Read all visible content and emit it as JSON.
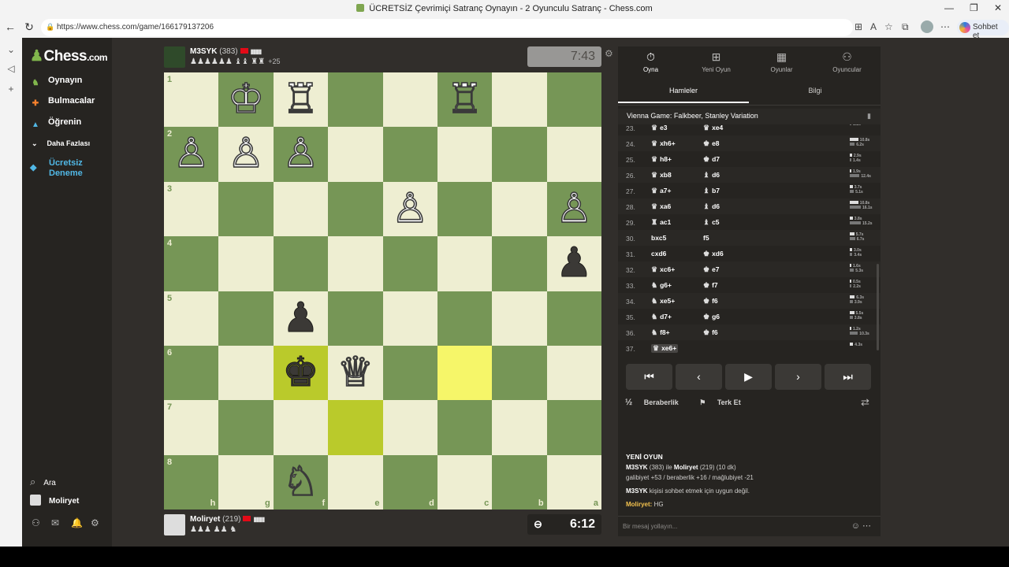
{
  "window": {
    "title": "ÜCRETSİZ Çevrimiçi Satranç Oynayın - 2 Oyunculu Satranç - Chess.com"
  },
  "browser": {
    "url": "https://www.chess.com/game/166179137206",
    "copilot_label": "Sohbet et"
  },
  "leftnav": {
    "logo": "Chess",
    "logo_suffix": ".com",
    "items": [
      {
        "label": "Oynayın",
        "icon": "play-icon",
        "color": "#81b64c"
      },
      {
        "label": "Bulmacalar",
        "icon": "puzzle-icon",
        "color": "#f7812d"
      },
      {
        "label": "Öğrenin",
        "icon": "learn-icon",
        "color": "#51b8e6"
      }
    ],
    "more_label": "Daha Fazlası",
    "trial_line1": "Ücretsiz",
    "trial_line2": "Deneme",
    "search_label": "Ara",
    "user_label": "Moliryet"
  },
  "top_player": {
    "name": "M3SYK",
    "rating": "(383)",
    "captured": "♟♟♟♟♟♟ ♝♝ ♜♜",
    "advantage": "+25",
    "clock": "7:43"
  },
  "bottom_player": {
    "name": "Moliryet",
    "rating": "(219)",
    "captured": "♟♟♟ ♟♟ ♞",
    "clock": "6:12"
  },
  "board": {
    "ranks": [
      "1",
      "2",
      "3",
      "4",
      "5",
      "6",
      "7",
      "8"
    ],
    "files": [
      "h",
      "g",
      "f",
      "e",
      "d",
      "c",
      "b",
      "a"
    ],
    "highlights": [
      "5-2",
      "5-5",
      "6-3"
    ],
    "pieces": [
      {
        "sq": "0-1",
        "p": "♔",
        "c": "w"
      },
      {
        "sq": "0-2",
        "p": "♖",
        "c": "w"
      },
      {
        "sq": "0-5",
        "p": "♖",
        "c": "w"
      },
      {
        "sq": "1-0",
        "p": "♙",
        "c": "w"
      },
      {
        "sq": "1-1",
        "p": "♙",
        "c": "w"
      },
      {
        "sq": "1-2",
        "p": "♙",
        "c": "w"
      },
      {
        "sq": "2-4",
        "p": "♙",
        "c": "w"
      },
      {
        "sq": "2-7",
        "p": "♙",
        "c": "w"
      },
      {
        "sq": "3-7",
        "p": "♟",
        "c": "b"
      },
      {
        "sq": "4-2",
        "p": "♟",
        "c": "b"
      },
      {
        "sq": "5-2",
        "p": "♚",
        "c": "b"
      },
      {
        "sq": "5-3",
        "p": "♕",
        "c": "w"
      },
      {
        "sq": "7-2",
        "p": "♘",
        "c": "w"
      }
    ]
  },
  "panel": {
    "tabs": [
      {
        "label": "Oyna",
        "icon": "clock-icon"
      },
      {
        "label": "Yeni Oyun",
        "icon": "plus-icon"
      },
      {
        "label": "Oyunlar",
        "icon": "board-icon"
      },
      {
        "label": "Oyuncular",
        "icon": "players-icon"
      }
    ],
    "subtabs": [
      "Hamleler",
      "Bilgi"
    ],
    "opening": "Vienna Game: Falkbeer, Stanley Variation",
    "moves": [
      {
        "n": "23.",
        "w": "e3",
        "wp": "♛",
        "b": "xe4",
        "bp": "♛",
        "tw": "",
        "tb": "2.2s"
      },
      {
        "n": "24.",
        "w": "xh6+",
        "wp": "♛",
        "b": "e8",
        "bp": "♚",
        "tw": "10.8s",
        "tb": "6.2s"
      },
      {
        "n": "25.",
        "w": "h8+",
        "wp": "♛",
        "b": "d7",
        "bp": "♚",
        "tw": "2.9s",
        "tb": "1.4s"
      },
      {
        "n": "26.",
        "w": "xb8",
        "wp": "♛",
        "b": "d6",
        "bp": "♝",
        "tw": "1.9s",
        "tb": "12.4s"
      },
      {
        "n": "27.",
        "w": "a7+",
        "wp": "♛",
        "b": "b7",
        "bp": "♝",
        "tw": "3.7s",
        "tb": "5.1s"
      },
      {
        "n": "28.",
        "w": "xa6",
        "wp": "♛",
        "b": "d6",
        "bp": "♝",
        "tw": "10.8s",
        "tb": "16.1s"
      },
      {
        "n": "29.",
        "w": "ac1",
        "wp": "♜",
        "b": "c5",
        "bp": "♝",
        "tw": "3.8s",
        "tb": "15.2s"
      },
      {
        "n": "30.",
        "w": "bxc5",
        "wp": "",
        "b": "f5",
        "bp": "",
        "tw": "5.7s",
        "tb": "6.7s"
      },
      {
        "n": "31.",
        "w": "cxd6",
        "wp": "",
        "b": "xd6",
        "bp": "♚",
        "tw": "3.0s",
        "tb": "3.4s"
      },
      {
        "n": "32.",
        "w": "xc6+",
        "wp": "♛",
        "b": "e7",
        "bp": "♚",
        "tw": "1.6s",
        "tb": "5.3s"
      },
      {
        "n": "33.",
        "w": "g6+",
        "wp": "♞",
        "b": "f7",
        "bp": "♚",
        "tw": "0.5s",
        "tb": "2.2s"
      },
      {
        "n": "34.",
        "w": "xe5+",
        "wp": "♞",
        "b": "f6",
        "bp": "♚",
        "tw": "6.3s",
        "tb": "3.9s"
      },
      {
        "n": "35.",
        "w": "d7+",
        "wp": "♞",
        "b": "g6",
        "bp": "♚",
        "tw": "5.5s",
        "tb": "3.8s"
      },
      {
        "n": "36.",
        "w": "f8+",
        "wp": "♞",
        "b": "f6",
        "bp": "♚",
        "tw": "1.2s",
        "tb": "10.3s"
      },
      {
        "n": "37.",
        "w": "xe6+",
        "wp": "♛",
        "b": "",
        "bp": "",
        "tw": "4.3s",
        "tb": ""
      }
    ],
    "draw_label": "Beraberlik",
    "resign_label": "Terk Et",
    "chat": {
      "header": "YENİ OYUN",
      "line1_a": "M3SYK",
      "line1_b": " (383) ile ",
      "line1_c": "Moliryet",
      "line1_d": " (219) (10 dk)",
      "line2": "galibiyet +53 / beraberlik +16 / mağlubiyet -21",
      "line3_a": "M3SYK",
      "line3_b": " kişisi sohbet etmek için uygun değil.",
      "line4_a": "Moliryet:",
      "line4_b": " HG"
    },
    "message_placeholder": "Bir mesaj yollayın..."
  }
}
